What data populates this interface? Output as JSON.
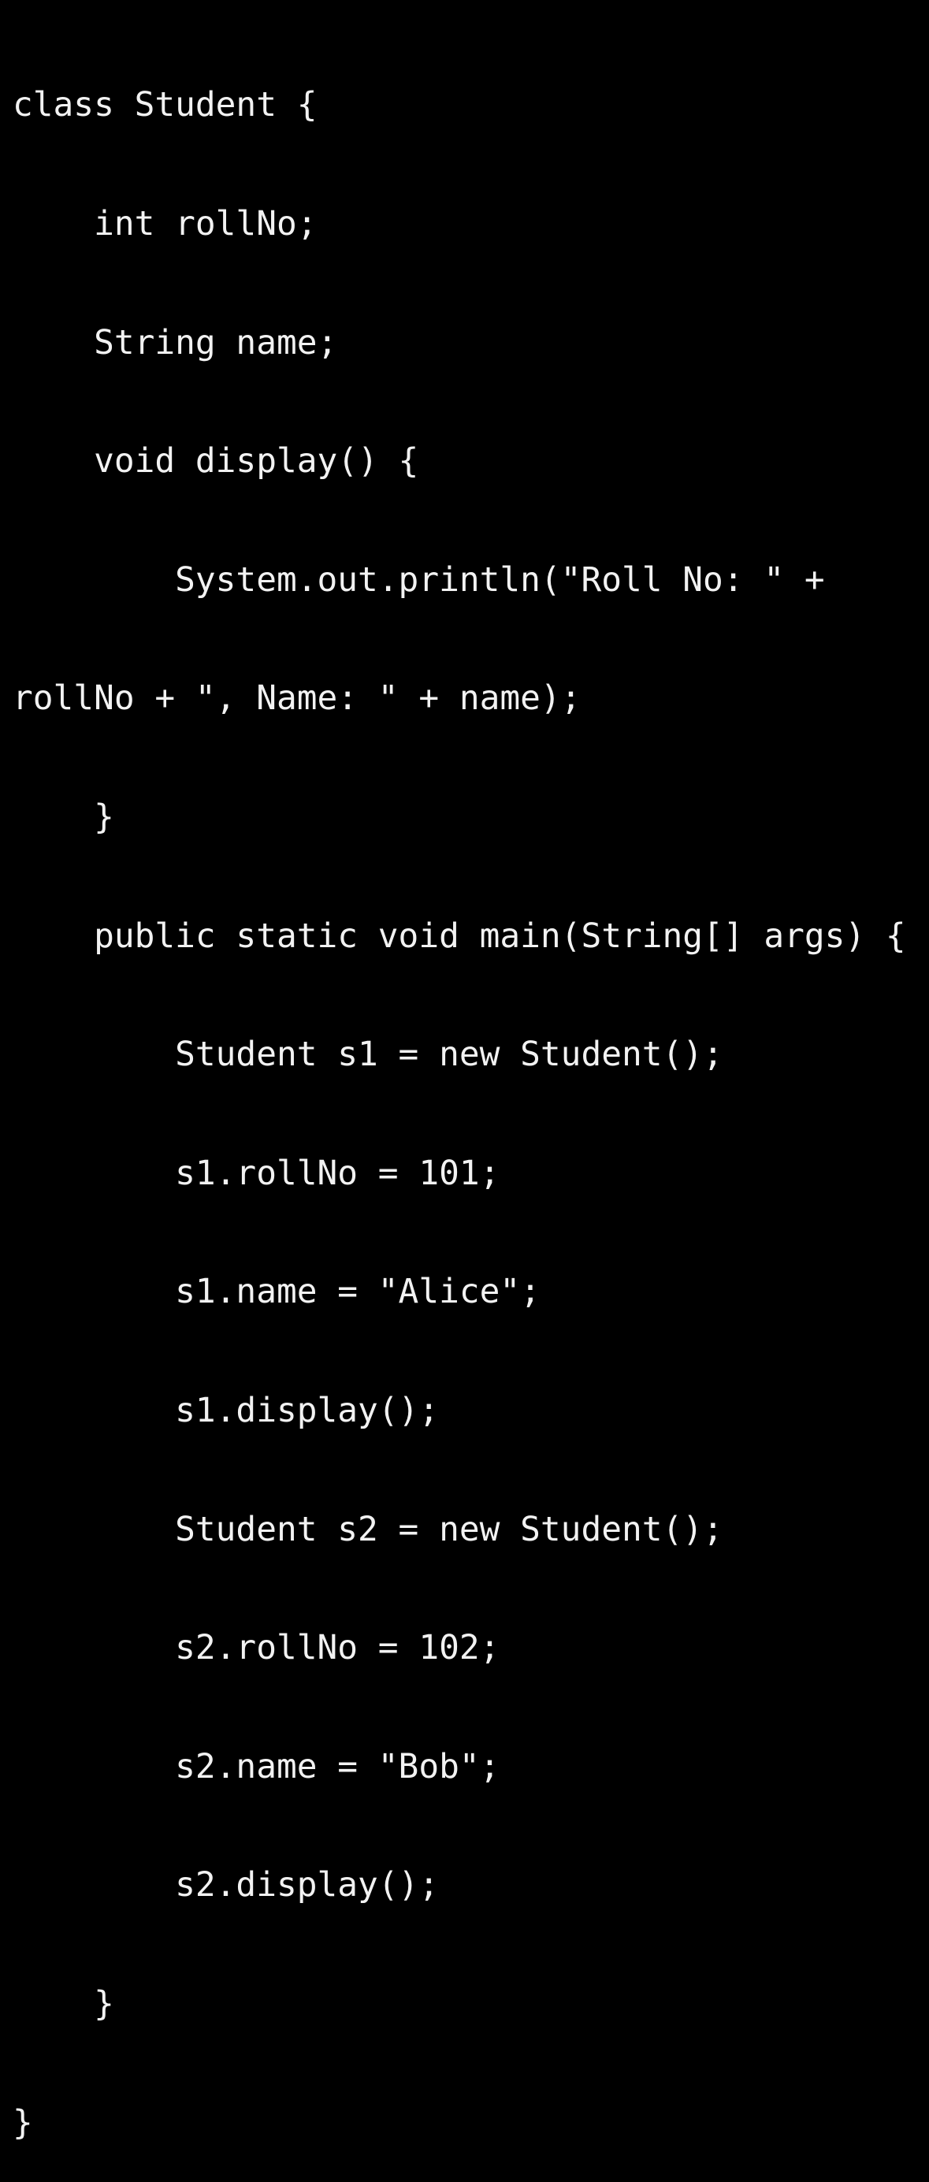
{
  "code": {
    "lines": [
      "class Student {",
      "    int rollNo;",
      "    String name;",
      "    void display() {",
      "        System.out.println(\"Roll No: \" +",
      "rollNo + \", Name: \" + name);",
      "    }",
      "    public static void main(String[] args) {",
      "        Student s1 = new Student();",
      "        s1.rollNo = 101;",
      "        s1.name = \"Alice\";",
      "        s1.display();",
      "        Student s2 = new Student();",
      "        s2.rollNo = 102;",
      "        s2.name = \"Bob\";",
      "        s2.display();",
      "    }",
      "}"
    ]
  },
  "colors": {
    "background": "#000000",
    "text": "#f2f2f2"
  }
}
